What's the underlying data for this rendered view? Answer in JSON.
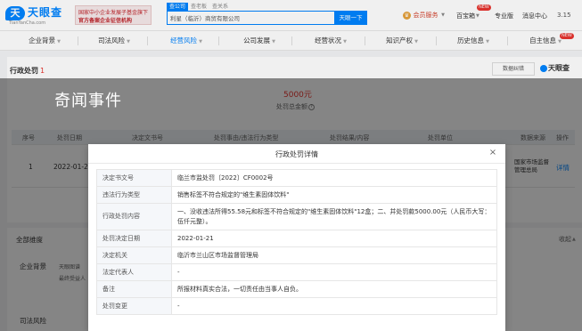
{
  "header": {
    "logo_text": "天眼查",
    "logo_mark": "天",
    "logo_url": "TianYanCha.com",
    "promo_line1": "国家中小企业发展子基金旗下",
    "promo_line2": "官方备案企业征信机构",
    "search_tabs": [
      "查公司",
      "查老板",
      "查关系"
    ],
    "search_value": "利星（临沂）商贸有限公司",
    "search_button": "天眼一下",
    "vip_label": "会员服务",
    "nav": [
      "百宝箱",
      "专业版",
      "消息中心",
      "3.15"
    ],
    "badge_new": "NEW"
  },
  "tabs": [
    {
      "label": "企业背景",
      "active": false
    },
    {
      "label": "司法风险",
      "active": false
    },
    {
      "label": "经营风险",
      "active": true
    },
    {
      "label": "公司发展",
      "active": false
    },
    {
      "label": "经营状况",
      "active": false
    },
    {
      "label": "知识产权",
      "active": false
    },
    {
      "label": "历史信息",
      "active": false
    },
    {
      "label": "自主信息",
      "active": false
    }
  ],
  "tab_badge": "NEW",
  "section": {
    "title": "行政处罚",
    "count": "1",
    "download_label": "数据纠错",
    "brand": "天眼查"
  },
  "overlay_text": "奇闻事件",
  "amount": {
    "value": "5000元",
    "label": "处罚总金额"
  },
  "table": {
    "headers": [
      "序号",
      "处罚日期",
      "决定文书号",
      "处罚事由/违法行为类型",
      "处罚结果/内容",
      "处罚单位",
      "数据来源",
      "操作"
    ],
    "row": {
      "index": "1",
      "date": "2022-01-21",
      "source": "国家市场监督管理总局",
      "action": "详情"
    }
  },
  "lower": {
    "dimension_title": "全部维度",
    "collapse": "收起",
    "company_bg": "企业背景",
    "item1": "天眼图谱",
    "item2": "最终受益人",
    "judicial": "司法风险"
  },
  "modal": {
    "title": "行政处罚详情",
    "close": "×",
    "rows": [
      {
        "k": "决定书文号",
        "v": "临兰市监处罚〔2022〕CF0002号"
      },
      {
        "k": "违法行为类型",
        "v": "销售标签不符合规定的\"维生素固体饮料\""
      },
      {
        "k": "行政处罚内容",
        "v": "一、没收违法所得55.58元和标签不符合规定的\"维生素固体饮料\"12盒；二、并处罚款5000.00元（人民币大写：伍仟元整）。"
      },
      {
        "k": "处罚决定日期",
        "v": "2022-01-21"
      },
      {
        "k": "决定机关",
        "v": "临沂市兰山区市场监督管理局"
      },
      {
        "k": "法定代表人",
        "v": "-"
      },
      {
        "k": "备注",
        "v": "所报材料真实合法，一切责任由当事人自负。"
      },
      {
        "k": "处罚变更",
        "v": "-"
      }
    ]
  }
}
